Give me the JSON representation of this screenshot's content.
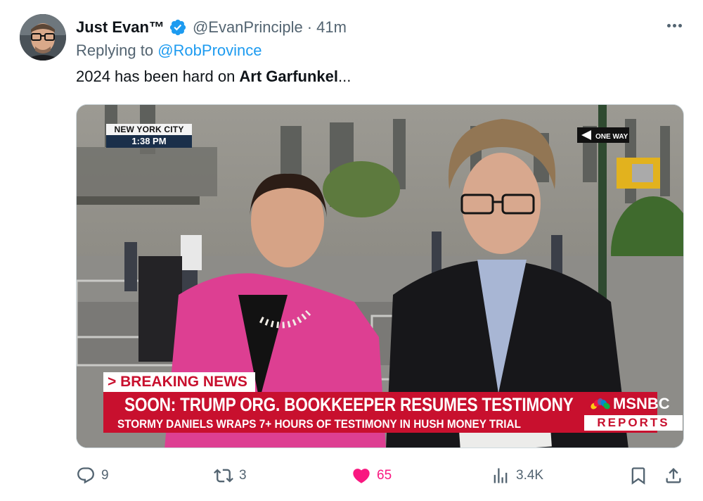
{
  "tweet": {
    "display_name": "Just Evan™",
    "handle": "@EvanPrinciple",
    "separator": "·",
    "time": "41m",
    "reply_prefix": "Replying to",
    "reply_to": "@RobProvince",
    "text_prefix": "2024 has been hard on ",
    "text_bold": "Art Garfunkel",
    "text_suffix": "..."
  },
  "media": {
    "location": "NEW YORK CITY",
    "clock": "1:38 PM",
    "street_sign": "ONE WAY",
    "banner": "> BREAKING NEWS",
    "headline": "SOON: TRUMP ORG. BOOKKEEPER RESUMES TESTIMONY",
    "subheadline": "STORMY DANIELS WRAPS 7+ HOURS OF TESTIMONY IN HUSH MONEY TRIAL",
    "network": "MSNBC",
    "program": "REPORTS"
  },
  "actions": {
    "replies": "9",
    "reposts": "3",
    "likes": "65",
    "views": "3.4K"
  },
  "colors": {
    "accent": "#1d9bf0",
    "like": "#f91880",
    "muted": "#536471",
    "chyron_red": "#c8102e"
  },
  "icons": [
    "verified-badge-icon",
    "more-icon",
    "reply-icon",
    "repost-icon",
    "like-icon",
    "views-icon",
    "bookmark-icon",
    "share-icon"
  ]
}
